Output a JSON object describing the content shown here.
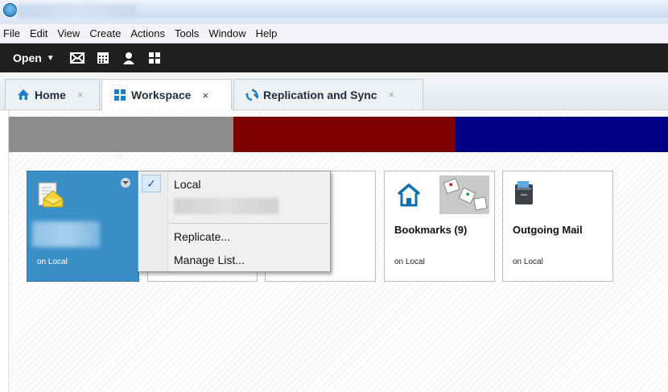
{
  "menu": [
    "File",
    "Edit",
    "View",
    "Create",
    "Actions",
    "Tools",
    "Window",
    "Help"
  ],
  "toolbar": {
    "open_label": "Open",
    "icons": [
      "mail-icon",
      "calendar-icon",
      "contacts-icon",
      "apps-icon"
    ]
  },
  "tabs": [
    {
      "label": "Home",
      "icon": "home-icon",
      "close": "×"
    },
    {
      "label": "Workspace",
      "icon": "workspace-icon",
      "close": "×"
    },
    {
      "label": "Replication and Sync",
      "icon": "sync-icon",
      "close": "×"
    }
  ],
  "bands": {
    "colors": [
      "#8c8c8c",
      "#7d0000",
      "#000085"
    ]
  },
  "cards": {
    "mail": {
      "sub": "on Local"
    },
    "bookmarks": {
      "title": "Bookmarks (9)",
      "sub": "on Local"
    },
    "outgoing": {
      "title": "Outgoing Mail",
      "sub": "on Local"
    }
  },
  "dropdown": {
    "check": "✓",
    "items": [
      "Local",
      "Replicate...",
      "Manage List..."
    ]
  }
}
